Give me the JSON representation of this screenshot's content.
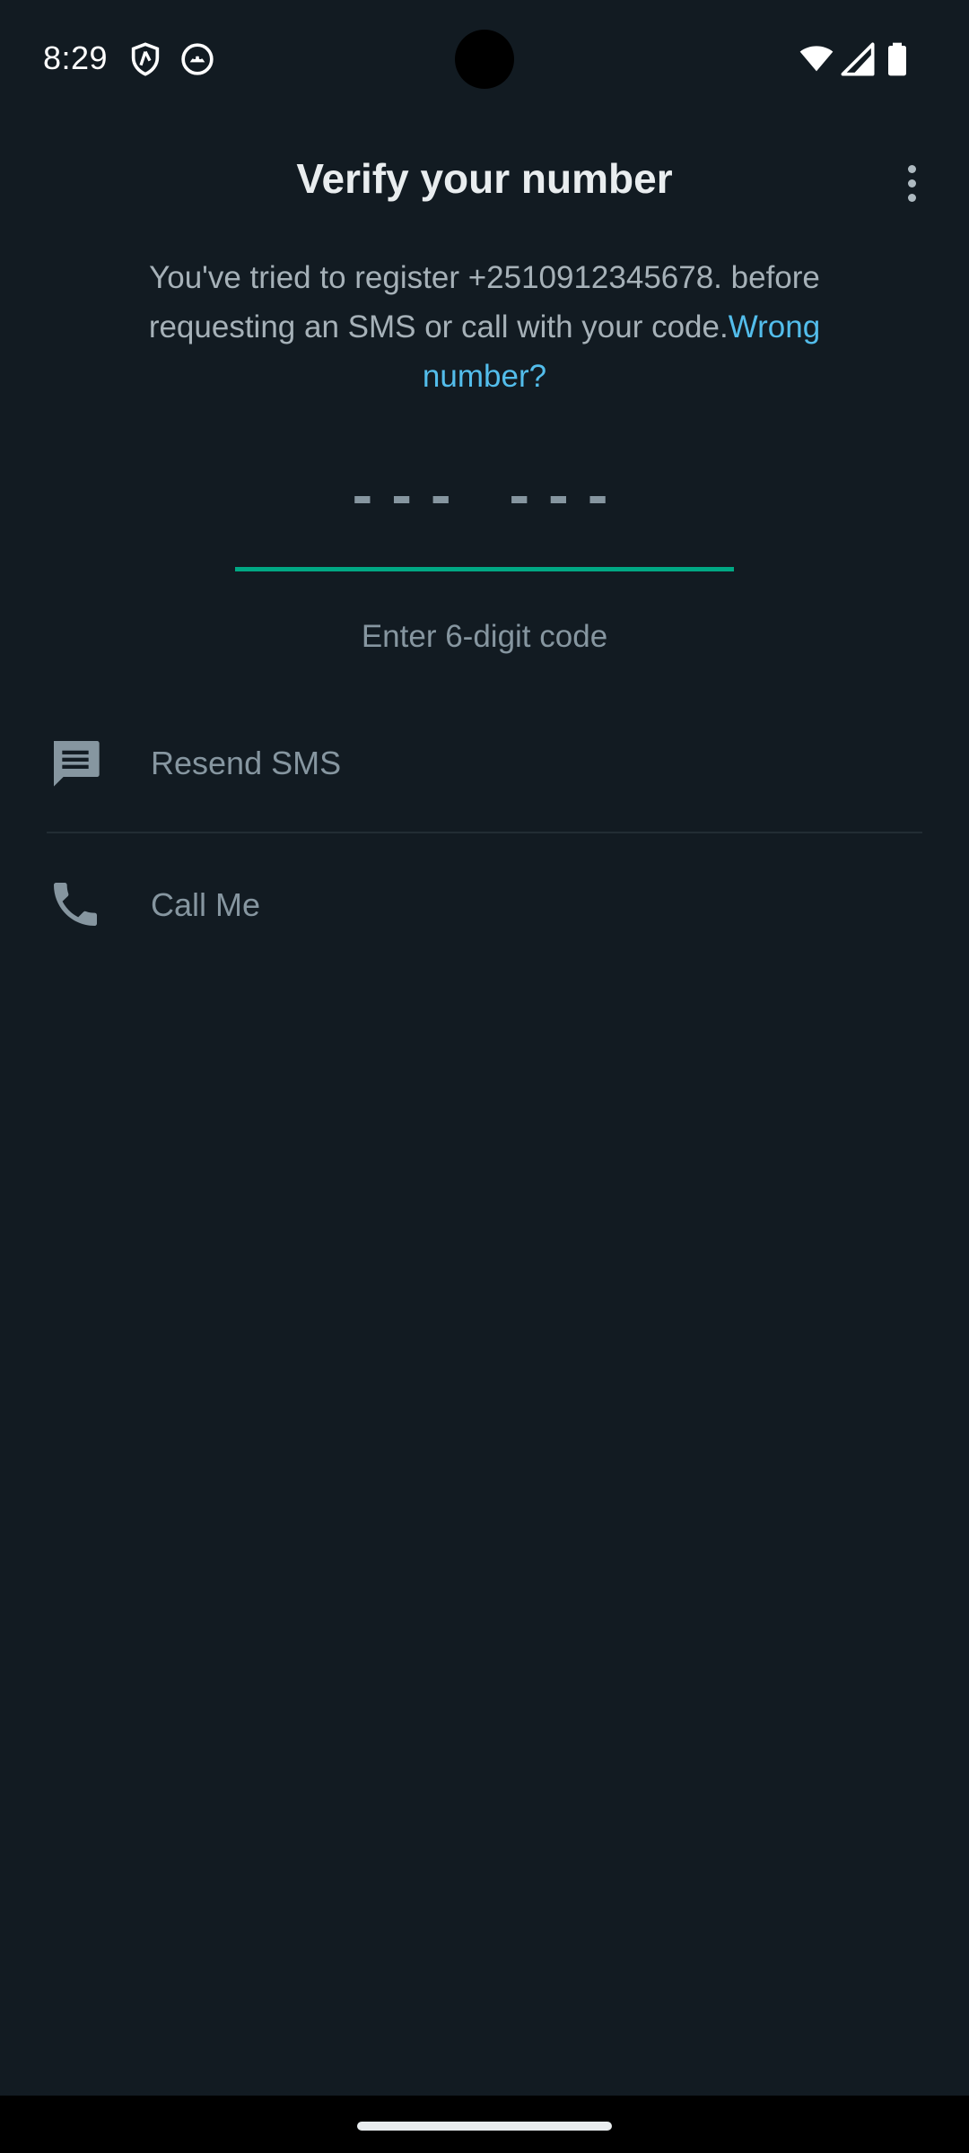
{
  "status_bar": {
    "time": "8:29",
    "icons": [
      "vpn-shield-icon",
      "app-notification-icon",
      "wifi-icon",
      "cellular-signal-icon",
      "battery-icon"
    ]
  },
  "header": {
    "title": "Verify your number",
    "menu_icon": "more-vert-icon"
  },
  "description": {
    "text": "You've tried to register +2510912345678. before requesting an SMS or call with your code.",
    "link": "Wrong number?"
  },
  "code_input": {
    "placeholder": "--- ---",
    "hint": "Enter 6-digit code"
  },
  "options": [
    {
      "label": "Resend SMS",
      "icon": "message-icon"
    },
    {
      "label": "Call Me",
      "icon": "phone-icon"
    }
  ],
  "colors": {
    "background": "#121b22",
    "accent": "#00a884",
    "link": "#53bdeb",
    "muted_text": "#8696a0"
  }
}
